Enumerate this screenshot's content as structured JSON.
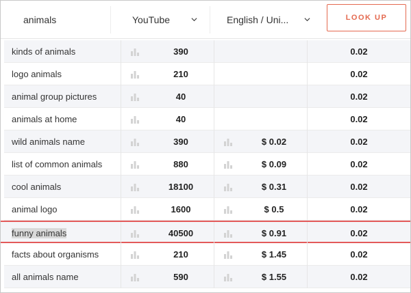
{
  "search": {
    "keyword": "animals",
    "source": "YouTube",
    "language": "English / Uni...",
    "lookup_label": "LOOK UP"
  },
  "colors": {
    "accent": "#e4694f",
    "highlight_line": "#e35a5a",
    "row_alt": "#f4f5f8"
  },
  "rows": [
    {
      "keyword": "kinds of animals",
      "volume": "390",
      "cpc": "",
      "competition": "0.02",
      "has_cpc_icon": false
    },
    {
      "keyword": "logo animals",
      "volume": "210",
      "cpc": "",
      "competition": "0.02",
      "has_cpc_icon": false
    },
    {
      "keyword": "animal group pictures",
      "volume": "40",
      "cpc": "",
      "competition": "0.02",
      "has_cpc_icon": false
    },
    {
      "keyword": "animals at home",
      "volume": "40",
      "cpc": "",
      "competition": "0.02",
      "has_cpc_icon": false
    },
    {
      "keyword": "wild animals name",
      "volume": "390",
      "cpc": "$ 0.02",
      "competition": "0.02",
      "has_cpc_icon": true
    },
    {
      "keyword": "list of common animals",
      "volume": "880",
      "cpc": "$ 0.09",
      "competition": "0.02",
      "has_cpc_icon": true
    },
    {
      "keyword": "cool animals",
      "volume": "18100",
      "cpc": "$ 0.31",
      "competition": "0.02",
      "has_cpc_icon": true
    },
    {
      "keyword": "animal logo",
      "volume": "1600",
      "cpc": "$ 0.5",
      "competition": "0.02",
      "has_cpc_icon": true
    },
    {
      "keyword": "funny animals",
      "volume": "40500",
      "cpc": "$ 0.91",
      "competition": "0.02",
      "has_cpc_icon": true,
      "selected": true
    },
    {
      "keyword": "facts about organisms",
      "volume": "210",
      "cpc": "$ 1.45",
      "competition": "0.02",
      "has_cpc_icon": true
    },
    {
      "keyword": "all animals name",
      "volume": "590",
      "cpc": "$ 1.55",
      "competition": "0.02",
      "has_cpc_icon": true
    }
  ]
}
